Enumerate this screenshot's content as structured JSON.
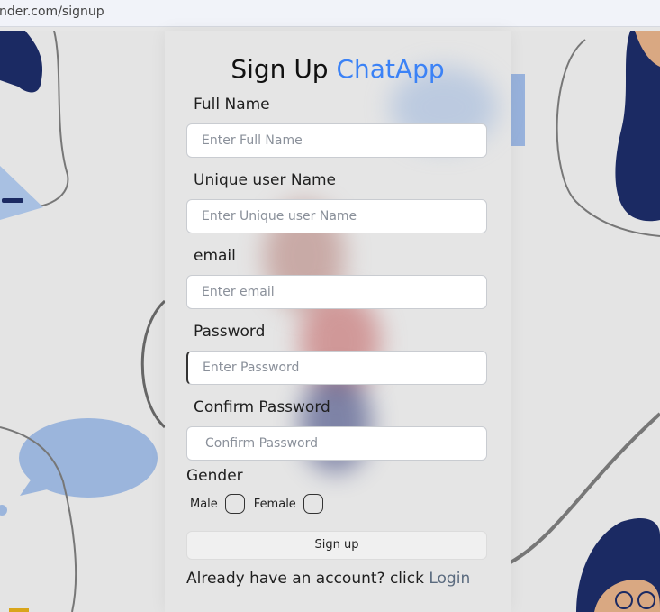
{
  "browser": {
    "url": "nder.com/signup"
  },
  "form": {
    "title": "Sign Up",
    "title_accent": "ChatApp",
    "accent_color": "#3b82f6",
    "fields": [
      {
        "label": "Full Name",
        "placeholder": "Enter Full Name"
      },
      {
        "label": "Unique user Name",
        "placeholder": "Enter Unique user Name"
      },
      {
        "label": "email",
        "placeholder": "Enter email"
      },
      {
        "label": "Password",
        "placeholder": "Enter Password"
      },
      {
        "label": "Confirm Password",
        "placeholder": "Confirm Password"
      }
    ],
    "gender_label": "Gender",
    "gender_options": [
      "Male",
      "Female"
    ],
    "submit_label": "Sign up",
    "footer_text": "Already have an account? click",
    "login_link": "Login"
  }
}
